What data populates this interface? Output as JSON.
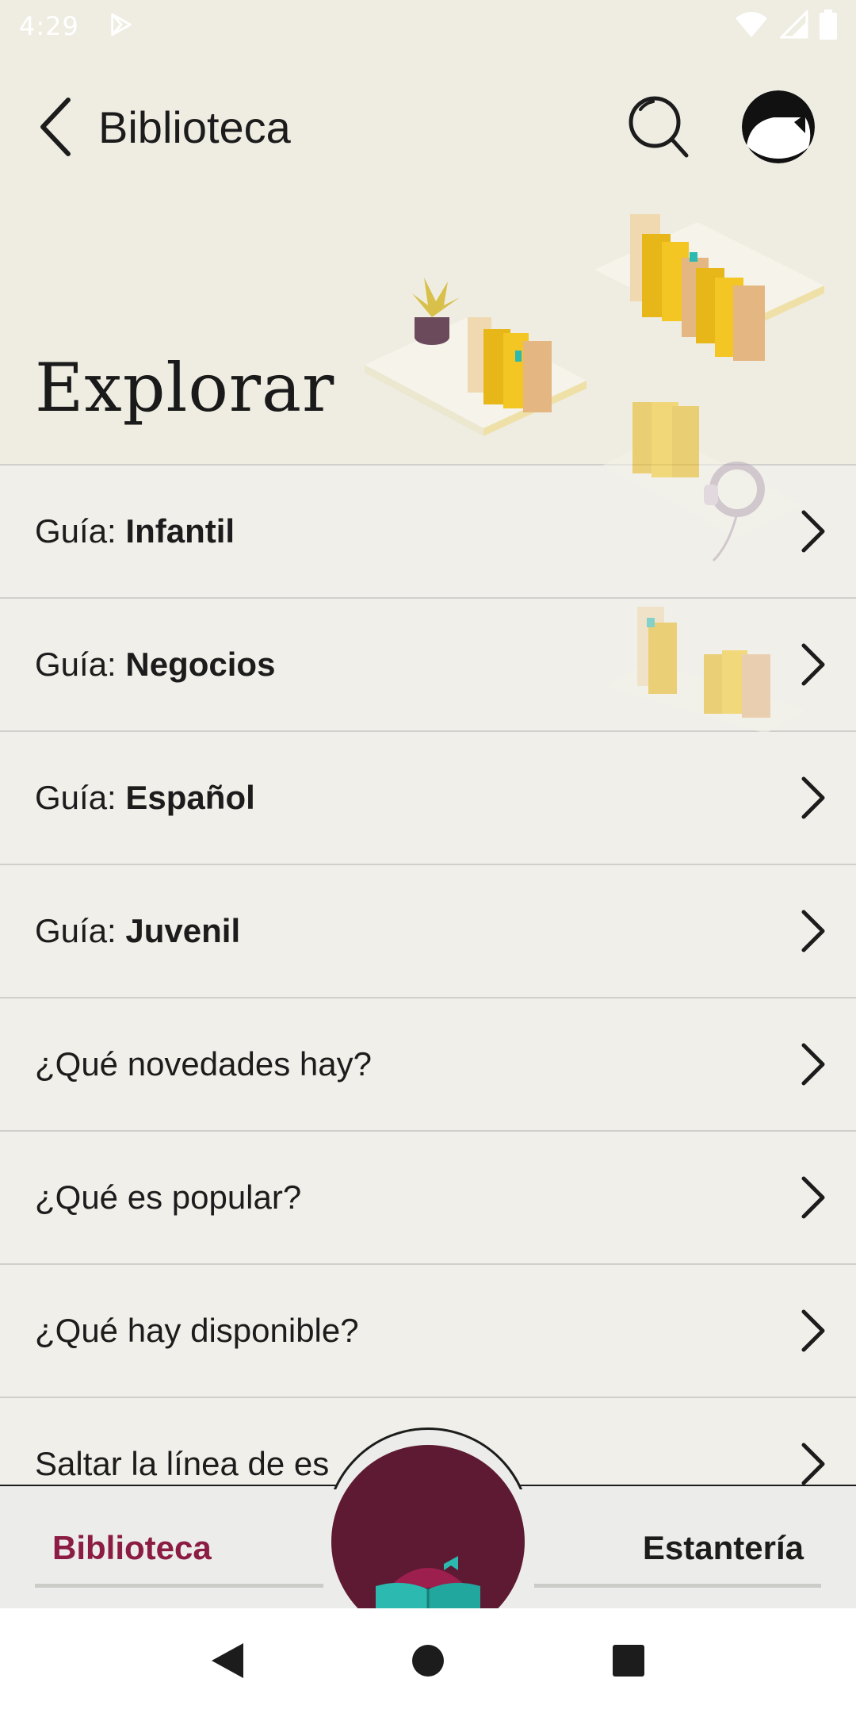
{
  "status_bar": {
    "time": "4:29"
  },
  "header": {
    "title": "Biblioteca",
    "explore_title": "Explorar"
  },
  "list": {
    "items": [
      {
        "prefix": "Guía: ",
        "bold": "Infantil"
      },
      {
        "prefix": "Guía: ",
        "bold": "Negocios"
      },
      {
        "prefix": "Guía: ",
        "bold": "Español"
      },
      {
        "prefix": "Guía: ",
        "bold": "Juvenil"
      },
      {
        "prefix": "¿Qué novedades hay?",
        "bold": ""
      },
      {
        "prefix": "¿Qué es popular?",
        "bold": ""
      },
      {
        "prefix": "¿Qué hay disponible?",
        "bold": ""
      },
      {
        "prefix": "Saltar la línea de es",
        "bold": ""
      }
    ]
  },
  "tabbar": {
    "library_label": "Biblioteca",
    "shelf_label": "Estantería"
  },
  "colors": {
    "header_bg": "#efede2",
    "page_bg": "#f0efe9",
    "accent": "#8b1c43",
    "fab": "#5e1a32",
    "book_yellow": "#e7b619",
    "book_tan": "#e4b681",
    "teal": "#2bb9b0"
  },
  "icons": {
    "back": "chevron-left-icon",
    "search": "search-icon",
    "avatar": "avatar-icon",
    "list_chevron": "chevron-right-icon",
    "nav_back": "triangle-back-icon",
    "nav_home": "circle-home-icon",
    "nav_recent": "square-recent-icon"
  }
}
